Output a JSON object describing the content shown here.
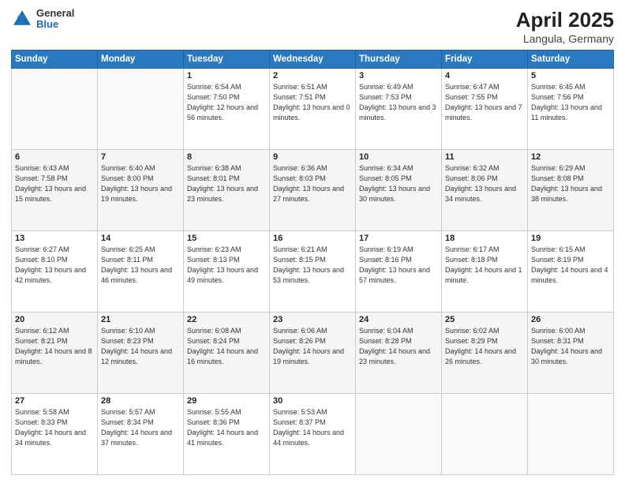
{
  "header": {
    "logo_line1": "General",
    "logo_line2": "Blue",
    "title": "April 2025",
    "subtitle": "Langula, Germany"
  },
  "days_header": [
    "Sunday",
    "Monday",
    "Tuesday",
    "Wednesday",
    "Thursday",
    "Friday",
    "Saturday"
  ],
  "weeks": [
    [
      {
        "day": "",
        "sunrise": "",
        "sunset": "",
        "daylight": ""
      },
      {
        "day": "",
        "sunrise": "",
        "sunset": "",
        "daylight": ""
      },
      {
        "day": "1",
        "sunrise": "Sunrise: 6:54 AM",
        "sunset": "Sunset: 7:50 PM",
        "daylight": "Daylight: 12 hours and 56 minutes."
      },
      {
        "day": "2",
        "sunrise": "Sunrise: 6:51 AM",
        "sunset": "Sunset: 7:51 PM",
        "daylight": "Daylight: 13 hours and 0 minutes."
      },
      {
        "day": "3",
        "sunrise": "Sunrise: 6:49 AM",
        "sunset": "Sunset: 7:53 PM",
        "daylight": "Daylight: 13 hours and 3 minutes."
      },
      {
        "day": "4",
        "sunrise": "Sunrise: 6:47 AM",
        "sunset": "Sunset: 7:55 PM",
        "daylight": "Daylight: 13 hours and 7 minutes."
      },
      {
        "day": "5",
        "sunrise": "Sunrise: 6:45 AM",
        "sunset": "Sunset: 7:56 PM",
        "daylight": "Daylight: 13 hours and 11 minutes."
      }
    ],
    [
      {
        "day": "6",
        "sunrise": "Sunrise: 6:43 AM",
        "sunset": "Sunset: 7:58 PM",
        "daylight": "Daylight: 13 hours and 15 minutes."
      },
      {
        "day": "7",
        "sunrise": "Sunrise: 6:40 AM",
        "sunset": "Sunset: 8:00 PM",
        "daylight": "Daylight: 13 hours and 19 minutes."
      },
      {
        "day": "8",
        "sunrise": "Sunrise: 6:38 AM",
        "sunset": "Sunset: 8:01 PM",
        "daylight": "Daylight: 13 hours and 23 minutes."
      },
      {
        "day": "9",
        "sunrise": "Sunrise: 6:36 AM",
        "sunset": "Sunset: 8:03 PM",
        "daylight": "Daylight: 13 hours and 27 minutes."
      },
      {
        "day": "10",
        "sunrise": "Sunrise: 6:34 AM",
        "sunset": "Sunset: 8:05 PM",
        "daylight": "Daylight: 13 hours and 30 minutes."
      },
      {
        "day": "11",
        "sunrise": "Sunrise: 6:32 AM",
        "sunset": "Sunset: 8:06 PM",
        "daylight": "Daylight: 13 hours and 34 minutes."
      },
      {
        "day": "12",
        "sunrise": "Sunrise: 6:29 AM",
        "sunset": "Sunset: 8:08 PM",
        "daylight": "Daylight: 13 hours and 38 minutes."
      }
    ],
    [
      {
        "day": "13",
        "sunrise": "Sunrise: 6:27 AM",
        "sunset": "Sunset: 8:10 PM",
        "daylight": "Daylight: 13 hours and 42 minutes."
      },
      {
        "day": "14",
        "sunrise": "Sunrise: 6:25 AM",
        "sunset": "Sunset: 8:11 PM",
        "daylight": "Daylight: 13 hours and 46 minutes."
      },
      {
        "day": "15",
        "sunrise": "Sunrise: 6:23 AM",
        "sunset": "Sunset: 8:13 PM",
        "daylight": "Daylight: 13 hours and 49 minutes."
      },
      {
        "day": "16",
        "sunrise": "Sunrise: 6:21 AM",
        "sunset": "Sunset: 8:15 PM",
        "daylight": "Daylight: 13 hours and 53 minutes."
      },
      {
        "day": "17",
        "sunrise": "Sunrise: 6:19 AM",
        "sunset": "Sunset: 8:16 PM",
        "daylight": "Daylight: 13 hours and 57 minutes."
      },
      {
        "day": "18",
        "sunrise": "Sunrise: 6:17 AM",
        "sunset": "Sunset: 8:18 PM",
        "daylight": "Daylight: 14 hours and 1 minute."
      },
      {
        "day": "19",
        "sunrise": "Sunrise: 6:15 AM",
        "sunset": "Sunset: 8:19 PM",
        "daylight": "Daylight: 14 hours and 4 minutes."
      }
    ],
    [
      {
        "day": "20",
        "sunrise": "Sunrise: 6:12 AM",
        "sunset": "Sunset: 8:21 PM",
        "daylight": "Daylight: 14 hours and 8 minutes."
      },
      {
        "day": "21",
        "sunrise": "Sunrise: 6:10 AM",
        "sunset": "Sunset: 8:23 PM",
        "daylight": "Daylight: 14 hours and 12 minutes."
      },
      {
        "day": "22",
        "sunrise": "Sunrise: 6:08 AM",
        "sunset": "Sunset: 8:24 PM",
        "daylight": "Daylight: 14 hours and 16 minutes."
      },
      {
        "day": "23",
        "sunrise": "Sunrise: 6:06 AM",
        "sunset": "Sunset: 8:26 PM",
        "daylight": "Daylight: 14 hours and 19 minutes."
      },
      {
        "day": "24",
        "sunrise": "Sunrise: 6:04 AM",
        "sunset": "Sunset: 8:28 PM",
        "daylight": "Daylight: 14 hours and 23 minutes."
      },
      {
        "day": "25",
        "sunrise": "Sunrise: 6:02 AM",
        "sunset": "Sunset: 8:29 PM",
        "daylight": "Daylight: 14 hours and 26 minutes."
      },
      {
        "day": "26",
        "sunrise": "Sunrise: 6:00 AM",
        "sunset": "Sunset: 8:31 PM",
        "daylight": "Daylight: 14 hours and 30 minutes."
      }
    ],
    [
      {
        "day": "27",
        "sunrise": "Sunrise: 5:58 AM",
        "sunset": "Sunset: 8:33 PM",
        "daylight": "Daylight: 14 hours and 34 minutes."
      },
      {
        "day": "28",
        "sunrise": "Sunrise: 5:57 AM",
        "sunset": "Sunset: 8:34 PM",
        "daylight": "Daylight: 14 hours and 37 minutes."
      },
      {
        "day": "29",
        "sunrise": "Sunrise: 5:55 AM",
        "sunset": "Sunset: 8:36 PM",
        "daylight": "Daylight: 14 hours and 41 minutes."
      },
      {
        "day": "30",
        "sunrise": "Sunrise: 5:53 AM",
        "sunset": "Sunset: 8:37 PM",
        "daylight": "Daylight: 14 hours and 44 minutes."
      },
      {
        "day": "",
        "sunrise": "",
        "sunset": "",
        "daylight": ""
      },
      {
        "day": "",
        "sunrise": "",
        "sunset": "",
        "daylight": ""
      },
      {
        "day": "",
        "sunrise": "",
        "sunset": "",
        "daylight": ""
      }
    ]
  ]
}
